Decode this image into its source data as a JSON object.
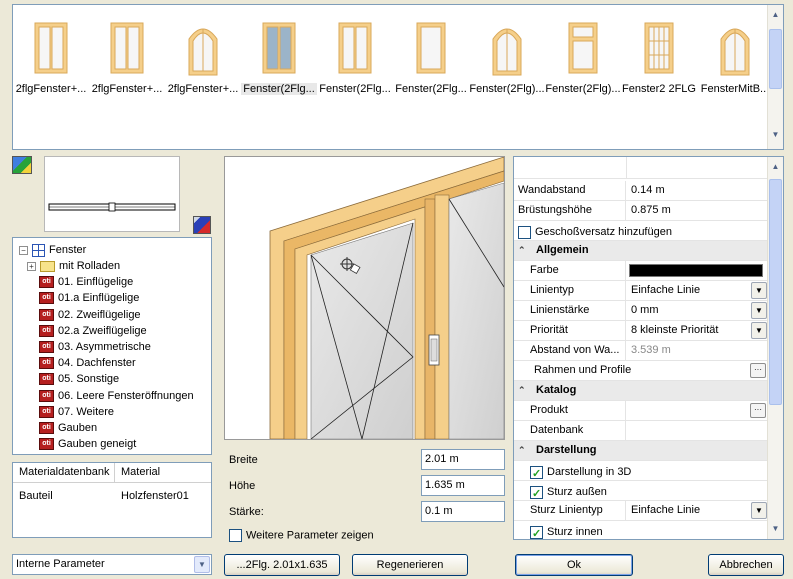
{
  "gallery": {
    "items": [
      {
        "label": "2flgFenster+...",
        "icon": "door-double-icon"
      },
      {
        "label": "2flgFenster+...",
        "icon": "window-double-icon"
      },
      {
        "label": "2flgFenster+...",
        "icon": "window-arch-icon"
      },
      {
        "label": "Fenster(2Flg...",
        "icon": "window-double-icon",
        "selected": true
      },
      {
        "label": "Fenster(2Flg...",
        "icon": "window-double-icon"
      },
      {
        "label": "Fenster(2Flg...",
        "icon": "window-single-icon"
      },
      {
        "label": "Fenster(2Flg)...",
        "icon": "window-arch-icon"
      },
      {
        "label": "Fenster(2Flg)...",
        "icon": "window-transom-icon"
      },
      {
        "label": "Fenster2 2FLG",
        "icon": "window-grid-icon"
      },
      {
        "label": "FensterMitB...",
        "icon": "window-arch-icon"
      }
    ]
  },
  "tree": {
    "root": "Fenster",
    "children": [
      {
        "label": "mit Rolladen",
        "type": "folder"
      },
      {
        "label": "01. Einflügelige",
        "type": "oti"
      },
      {
        "label": "01.a Einflügelige",
        "type": "oti"
      },
      {
        "label": "02. Zweiflügelige",
        "type": "oti"
      },
      {
        "label": "02.a Zweiflügelige",
        "type": "oti"
      },
      {
        "label": "03. Asymmetrische",
        "type": "oti"
      },
      {
        "label": "04. Dachfenster",
        "type": "oti"
      },
      {
        "label": "05. Sonstige",
        "type": "oti"
      },
      {
        "label": "06. Leere Fensteröffnungen",
        "type": "oti"
      },
      {
        "label": "07. Weitere",
        "type": "oti"
      },
      {
        "label": "Gauben",
        "type": "oti"
      },
      {
        "label": "Gauben geneigt",
        "type": "oti"
      }
    ],
    "oti_glyph": "oti"
  },
  "material_table": {
    "headers": [
      "Materialdatenbank",
      "Material"
    ],
    "rows": [
      [
        "Bauteil",
        "Holzfenster01"
      ]
    ]
  },
  "params": {
    "breite_label": "Breite",
    "breite_value": "2.01 m",
    "hoehe_label": "Höhe",
    "hoehe_value": "1.635 m",
    "staerke_label": "Stärke:",
    "staerke_value": "0.1 m",
    "more_label": "Weitere Parameter zeigen"
  },
  "props": {
    "rows": [
      {
        "name": "Wandabstand",
        "value": "0.14 m"
      },
      {
        "name": "Brüstungshöhe",
        "value": "0.875 m"
      },
      {
        "check": true,
        "checked": false,
        "label": "Geschoßversatz hinzufügen"
      },
      {
        "cat": "Allgemein"
      },
      {
        "name": "Farbe",
        "value": "",
        "color": "#000000"
      },
      {
        "name": "Linientyp",
        "value": "Einfache Linie",
        "dropdown": true
      },
      {
        "name": "Linienstärke",
        "value": "0 mm",
        "dropdown": true
      },
      {
        "name": "Priorität",
        "value": "8 kleinste Priorität",
        "dropdown": true
      },
      {
        "name": "Abstand von Wa...",
        "value": "3.539 m",
        "gray": true
      },
      {
        "name": "Rahmen und Profile",
        "value": "",
        "ellipsis": true,
        "full": true
      },
      {
        "cat": "Katalog"
      },
      {
        "name": "Produkt",
        "value": "",
        "ellipsis": true
      },
      {
        "name": "Datenbank",
        "value": ""
      },
      {
        "cat": "Darstellung"
      },
      {
        "check": true,
        "checked": true,
        "label": "Darstellung in 3D"
      },
      {
        "check": true,
        "checked": true,
        "label": "Sturz außen"
      },
      {
        "name": "Sturz Linientyp",
        "value": "Einfache Linie",
        "dropdown": true
      },
      {
        "check": true,
        "checked": true,
        "label": "Sturz innen"
      }
    ]
  },
  "bottom": {
    "combo_value": "Interne Parameter",
    "size_button": "...2Flg. 2.01x1.635",
    "regen_button": "Regenerieren",
    "ok_button": "Ok",
    "cancel_button": "Abbrechen"
  },
  "colors": {
    "frame": "#f5cf8a",
    "frame_dark": "#d9a85a",
    "glass_selected": "#9bb4c9"
  }
}
